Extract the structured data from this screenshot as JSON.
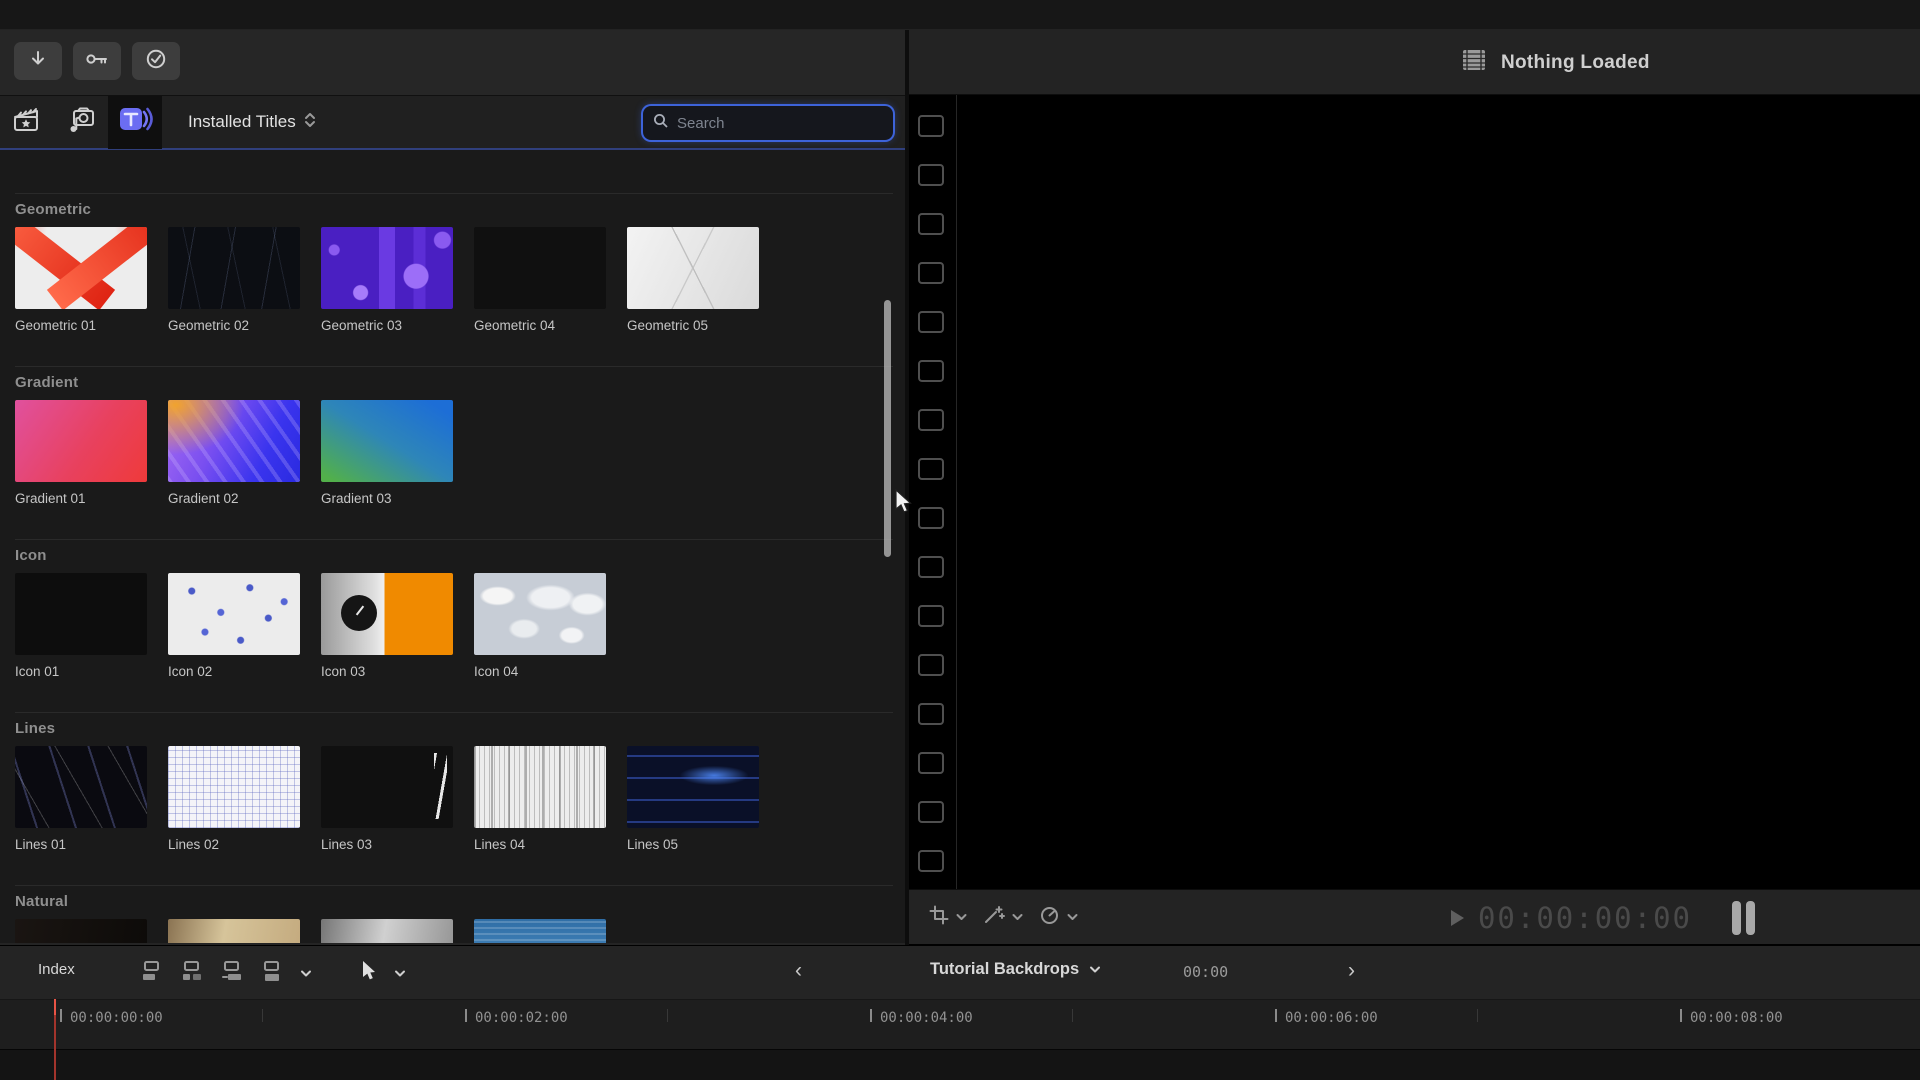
{
  "colors": {
    "accent_blue": "#3d63d9",
    "titles_icon_blue": "#7577f5",
    "playhead_red": "#c0392b",
    "panel_dark": "#1a1a1a"
  },
  "topbar": {
    "buttons": [
      {
        "name": "download"
      },
      {
        "name": "key"
      },
      {
        "name": "check"
      }
    ]
  },
  "browser": {
    "tabs": [
      {
        "name": "media"
      },
      {
        "name": "photos-audio"
      },
      {
        "name": "titles-generators",
        "selected": true
      }
    ],
    "dropdown_label": "Installed Titles",
    "search_placeholder": "Search",
    "sections": [
      {
        "title": "Geometric",
        "items": [
          {
            "label": "Geometric 01",
            "art": "geo01"
          },
          {
            "label": "Geometric 02",
            "art": "geo02"
          },
          {
            "label": "Geometric 03",
            "art": "geo03"
          },
          {
            "label": "Geometric 04",
            "art": "geo04"
          },
          {
            "label": "Geometric 05",
            "art": "geo05"
          }
        ]
      },
      {
        "title": "Gradient",
        "items": [
          {
            "label": "Gradient 01",
            "art": "grad01"
          },
          {
            "label": "Gradient 02",
            "art": "grad02"
          },
          {
            "label": "Gradient 03",
            "art": "grad03"
          }
        ]
      },
      {
        "title": "Icon",
        "items": [
          {
            "label": "Icon 01",
            "art": "icon01"
          },
          {
            "label": "Icon 02",
            "art": "icon02"
          },
          {
            "label": "Icon 03",
            "art": "icon03"
          },
          {
            "label": "Icon 04",
            "art": "icon04"
          }
        ]
      },
      {
        "title": "Lines",
        "items": [
          {
            "label": "Lines 01",
            "art": "lines01"
          },
          {
            "label": "Lines 02",
            "art": "lines02"
          },
          {
            "label": "Lines 03",
            "art": "lines03"
          },
          {
            "label": "Lines 04",
            "art": "lines04"
          },
          {
            "label": "Lines 05",
            "art": "lines05"
          }
        ]
      },
      {
        "title": "Natural",
        "items": [
          {
            "label": "",
            "art": "nat01"
          },
          {
            "label": "",
            "art": "nat02"
          },
          {
            "label": "",
            "art": "nat03"
          },
          {
            "label": "",
            "art": "nat04"
          }
        ]
      }
    ]
  },
  "viewer": {
    "status": "Nothing Loaded",
    "timecode": "00:00:00:00",
    "sprocket_count": 16
  },
  "timeline": {
    "index_label": "Index",
    "nav_back": "‹",
    "nav_forward": "›",
    "project_name": "Tutorial Backdrops",
    "current_time": "00:00",
    "ruler_ticks": [
      "00:00:00:00",
      "00:00:02:00",
      "00:00:04:00",
      "00:00:06:00",
      "00:00:08:00"
    ]
  }
}
